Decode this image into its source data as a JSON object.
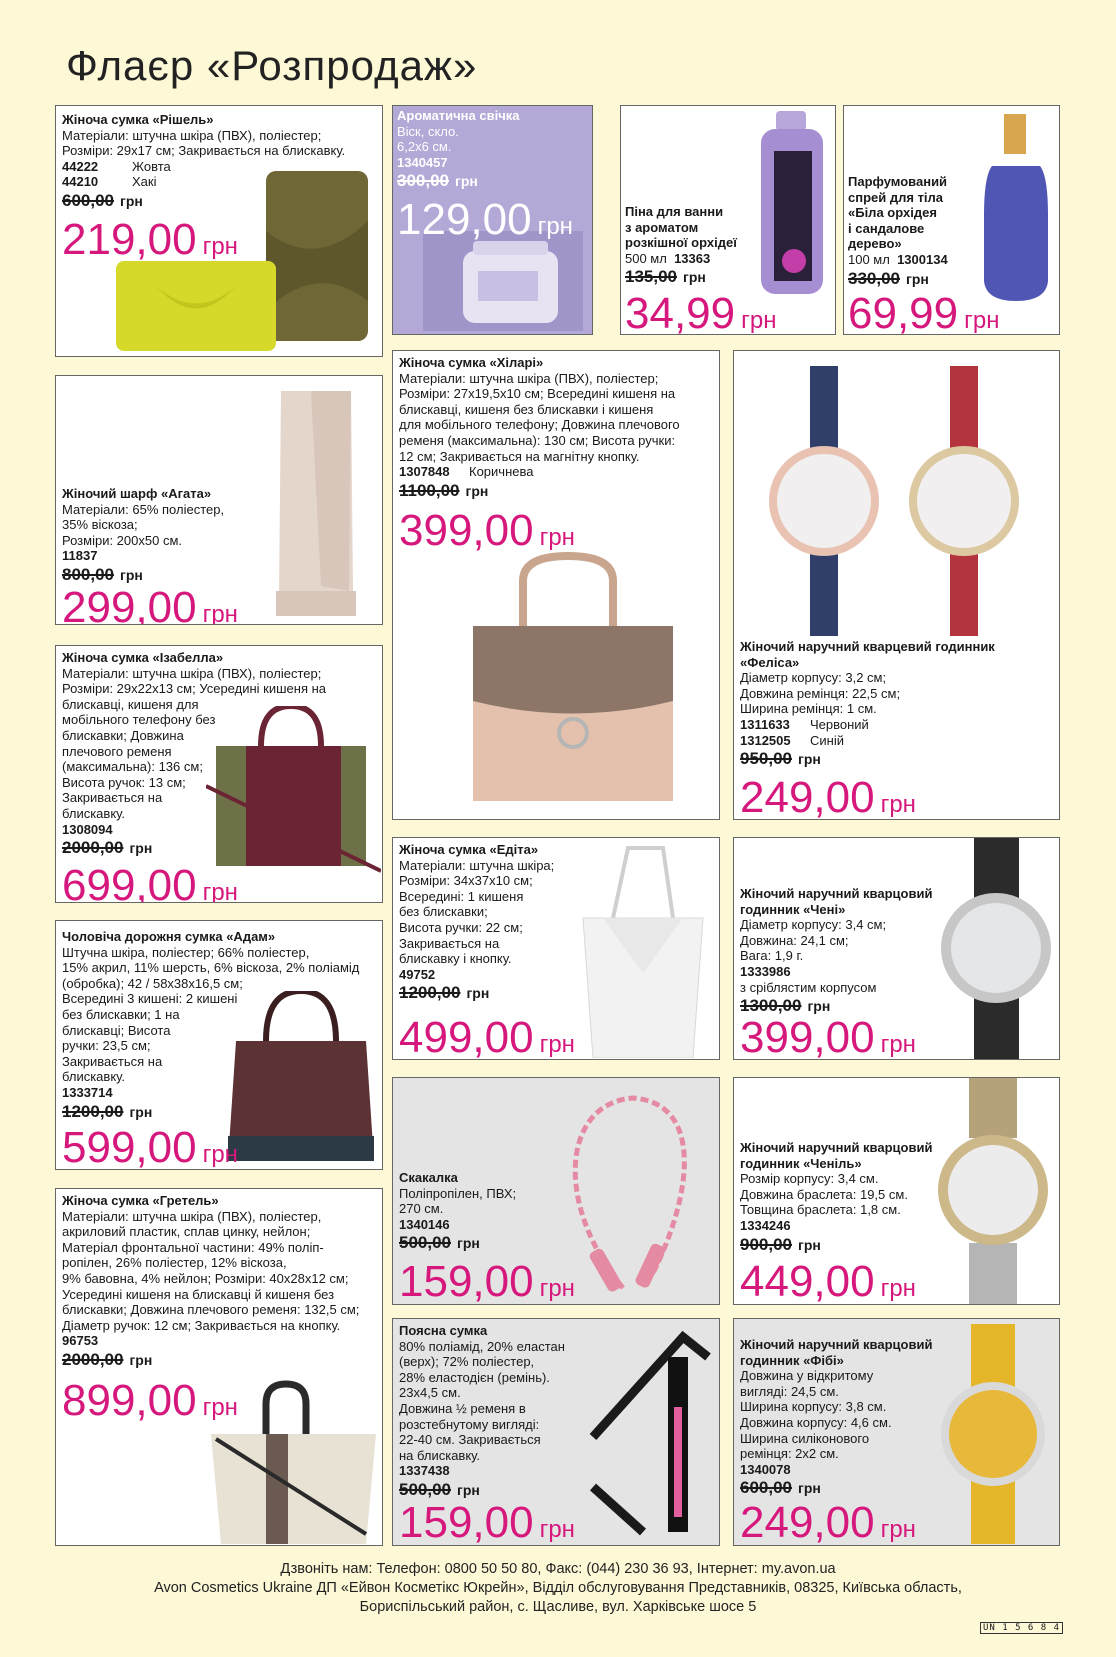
{
  "title": "Флаєр «Розпродаж»",
  "currency": "грн",
  "products": {
    "richelieu": {
      "name": "Жіноча сумка «Рішель»",
      "desc": [
        "Матеріали: штучна шкіра (ПВХ), поліестер;",
        "Розміри: 29х17 см; Закривається на блискавку."
      ],
      "variants": [
        {
          "code": "44222",
          "label": "Жовта"
        },
        {
          "code": "44210",
          "label": "Хакі"
        }
      ],
      "old_price": "600,00",
      "price": "219,00"
    },
    "candle": {
      "name": "Ароматична свічка",
      "desc": [
        "Віск, скло.",
        "6,2х6 см."
      ],
      "code": "1340457",
      "old_price": "300,00",
      "price": "129,00"
    },
    "foam": {
      "name_lines": [
        "Піна для ванни",
        "з ароматом",
        "розкішної орхідеї"
      ],
      "volume": "500 мл",
      "code": "13363",
      "old_price": "135,00",
      "price": "34,99"
    },
    "spray": {
      "name_lines": [
        "Парфумований",
        "спрей для тіла",
        "«Біла орхідея",
        "і сандалове",
        "дерево»"
      ],
      "volume": "100 мл",
      "code": "1300134",
      "old_price": "330,00",
      "price": "69,99"
    },
    "agata": {
      "name": "Жіночий шарф «Агата»",
      "desc": [
        "Матеріали: 65% поліестер,",
        "35% віскоза;",
        "Розміри: 200х50 см."
      ],
      "code": "11837",
      "old_price": "800,00",
      "price": "299,00"
    },
    "hilary": {
      "name": "Жіноча сумка «Хіларі»",
      "desc": [
        "Матеріали: штучна шкіра (ПВХ), поліестер;",
        "Розміри: 27х19,5х10 см; Всередині кишеня на",
        "блискавці, кишеня без блискавки і кишеня",
        "для мобільного телефону; Довжина плечового",
        "ременя (максимальна): 130 см; Висота ручки:",
        "12 см; Закривається на магнітну кнопку."
      ],
      "variants": [
        {
          "code": "1307848",
          "label": "Коричнева"
        }
      ],
      "old_price": "1100,00",
      "price": "399,00"
    },
    "felisa": {
      "name": "Жіночий наручний кварцевий годинник «Феліса»",
      "desc": [
        "Діаметр корпусу: 3,2 см;",
        "Довжина ремінця: 22,5 см;",
        "Ширина ремінця: 1 см."
      ],
      "variants": [
        {
          "code": "1311633",
          "label": "Червоний"
        },
        {
          "code": "1312505",
          "label": "Синій"
        }
      ],
      "old_price": "950,00",
      "price": "249,00"
    },
    "izabella": {
      "name": "Жіноча сумка «Ізабелла»",
      "desc": [
        "Матеріали: штучна шкіра (ПВХ), поліестер;",
        "Розміри: 29х22х13 см; Усередині кишеня на",
        "блискавці, кишеня для",
        "мобільного телефону без",
        "блискавки; Довжина",
        "плечового ременя",
        "(максимальна): 136 см;",
        "Висота ручок: 13 см;",
        "Закривається на",
        "блискавку."
      ],
      "code": "1308094",
      "old_price": "2000,00",
      "price": "699,00"
    },
    "edita": {
      "name": "Жіноча сумка «Едіта»",
      "desc": [
        "Матеріали: штучна шкіра;",
        "Розміри: 34х37х10 см;",
        "Всередині: 1 кишеня",
        "без блискавки;",
        "Висота ручки: 22 см;",
        "Закривається на",
        "блискавку і кнопку."
      ],
      "code": "49752",
      "old_price": "1200,00",
      "price": "499,00"
    },
    "cheni": {
      "name": "Жіночий наручний кварцовий годинник «Чені»",
      "desc": [
        "Діаметр корпусу: 3,4 см;",
        "Довжина: 24,1 см;",
        "Вага: 1,9 г."
      ],
      "code": "1333986",
      "note": "з сріблястим корпусом",
      "old_price": "1300,00",
      "price": "399,00"
    },
    "adam": {
      "name": "Чоловіча дорожня сумка «Адам»",
      "desc": [
        "Штучна шкіра, поліестер; 66% поліестер,",
        "15% акрил, 11% шерсть, 6% віскоза, 2% поліамід",
        "(обробка); 42 / 58х38х16,5 см;",
        "Всередині 3 кишені: 2 кишені",
        "без блискавки; 1 на",
        "блискавці; Висота",
        "ручки: 23,5 см;",
        "Закривається на",
        "блискавку."
      ],
      "code": "1333714",
      "old_price": "1200,00",
      "price": "599,00"
    },
    "rope": {
      "name": "Скакалка",
      "desc": [
        "Поліпропілен, ПВХ;",
        "270 см."
      ],
      "code": "1340146",
      "old_price": "500,00",
      "price": "159,00"
    },
    "chenil": {
      "name": "Жіночий наручний кварцовий годинник «Ченіль»",
      "desc": [
        "Розмір корпусу: 3,4 см.",
        "Довжина браслета: 19,5 см.",
        "Товщина браслета: 1,8 см."
      ],
      "code": "1334246",
      "old_price": "900,00",
      "price": "449,00"
    },
    "gretel": {
      "name": "Жіноча сумка «Гретель»",
      "desc": [
        "Матеріали: штучна шкіра (ПВХ), поліестер,",
        "акриловий пластик, сплав цинку, нейлон;",
        "Матеріал фронтальної частини: 49% поліп-",
        "ропілен, 26% поліестер, 12% віскоза,",
        "9% бавовна, 4% нейлон; Розміри: 40х28х12 см;",
        "Усередині кишеня на блискавці й кишеня без",
        "блискавки; Довжина плечового ременя: 132,5 см;",
        "Діаметр ручок: 12 см; Закривається на кнопку."
      ],
      "code": "96753",
      "old_price": "2000,00",
      "price": "899,00"
    },
    "beltbag": {
      "name": "Поясна сумка",
      "desc": [
        "80% поліамід, 20% еластан",
        "(верх); 72% поліестер,",
        "28% еластодієн (ремінь).",
        "23х4,5 см.",
        "Довжина ½ ременя в",
        "розстебнутому вигляді:",
        "22-40 см. Закривається",
        "на блискавку."
      ],
      "code": "1337438",
      "old_price": "500,00",
      "price": "159,00"
    },
    "fibi": {
      "name": "Жіночий наручний кварцовий годинник «Фібі»",
      "desc": [
        "Довжина у відкритому",
        "вигляді: 24,5 см.",
        "Ширина корпусу: 3,8 см.",
        "Довжина корпусу: 4,6 см.",
        "Ширина силіконового",
        "ремінця: 2х2 см."
      ],
      "code": "1340078",
      "old_price": "600,00",
      "price": "249,00"
    }
  },
  "footer": {
    "line1": "Дзвоніть нам: Телефон: 0800 50 50 80, Факс: (044) 230 36 93, Інтернет: my.avon.ua",
    "line2": "Avon Cosmetics Ukraine ДП «Ейвон Косметікс Юкрейн», Відділ обслуговування Представників, 08325, Київська область,",
    "line3": "Бориспільський район, с. Щасливе, вул. Харківське шосе 5",
    "code": "UN 1 5 6 8 4"
  },
  "colors": {
    "price": "#d6187d",
    "background": "#fdf8d6",
    "candle_card": "#b3a8d6"
  }
}
